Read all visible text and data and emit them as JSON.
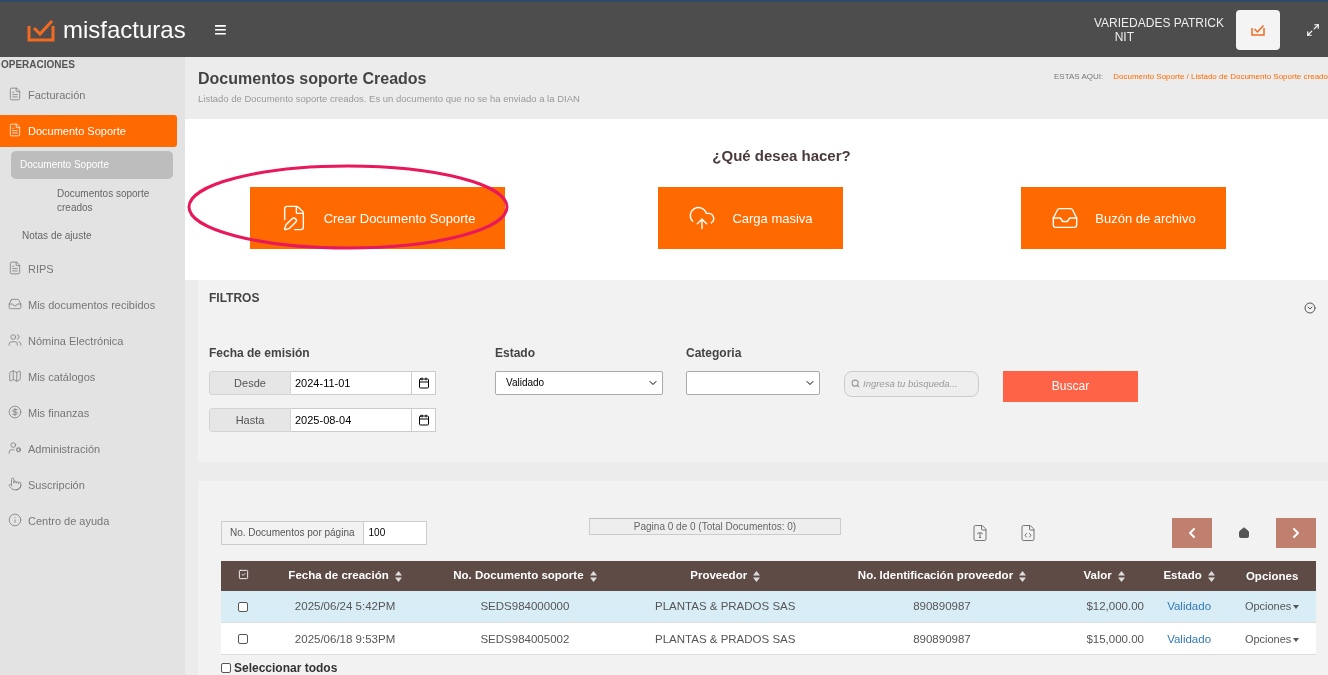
{
  "header": {
    "brand": "misfacturas",
    "menu_glyph": "≡",
    "company": "VARIEDADES PATRICK",
    "nit": "NIT"
  },
  "sidebar": {
    "section": "OPERACIONES",
    "items": [
      {
        "label": "Facturación",
        "kind": "receipt",
        "selected": false
      },
      {
        "label": "Documento Soporte",
        "kind": "receipt",
        "selected": true,
        "children": [
          {
            "label": "Documento Soporte",
            "selected": true,
            "children": [
              {
                "label": "Documentos soporte creados",
                "selected": false
              }
            ]
          },
          {
            "label": "Notas de ajuste",
            "selected": false
          }
        ]
      },
      {
        "label": "RIPS",
        "kind": "receipt",
        "selected": false
      },
      {
        "label": "Mis documentos recibidos",
        "kind": "inbox",
        "selected": false
      },
      {
        "label": "Nómina Electrónica",
        "kind": "users",
        "selected": false
      },
      {
        "label": "Mis catálogos",
        "kind": "map",
        "selected": false
      },
      {
        "label": "Mis finanzas",
        "kind": "dollar",
        "selected": false
      },
      {
        "label": "Administración",
        "kind": "admin",
        "selected": false
      },
      {
        "label": "Suscripción",
        "kind": "hand",
        "selected": false
      },
      {
        "label": "Centro de ayuda",
        "kind": "info",
        "selected": false
      }
    ]
  },
  "page": {
    "title": "Documentos soporte Creados",
    "subtitle": "Listado de Documento soporte creados. Es un documento que no se ha enviado a la DIAN",
    "breadcrumb_label": "ESTAS AQUI:",
    "breadcrumb": "Documento Soporte / Listado de Documento Soporte creado"
  },
  "actions": {
    "question": "¿Qué desea hacer?",
    "buttons": [
      {
        "label": "Crear Documento Soporte",
        "kind": "document",
        "highlighted": true
      },
      {
        "label": "Carga masiva",
        "kind": "upload",
        "highlighted": false
      },
      {
        "label": "Buzón de archivo",
        "kind": "inbox",
        "highlighted": false
      }
    ]
  },
  "filters": {
    "title": "FILTROS",
    "date_label": "Fecha de emisión",
    "from_label": "Desde",
    "from_value": "2024-11-01",
    "to_label": "Hasta",
    "to_value": "2025-08-04",
    "status_label": "Estado",
    "status_value": "Validado",
    "category_label": "Categoria",
    "search_placeholder": "Ingresa tu búsqueda...",
    "search_button": "Buscar"
  },
  "table": {
    "per_page_label": "No. Documentos por página",
    "per_page_value": "100",
    "pagination": "Pagina 0 de 0 (Total Documentos: 0)",
    "columns": [
      "Fecha de creación",
      "No. Documento soporte",
      "Proveedor",
      "No. Identificación proveedor",
      "Valor",
      "Estado",
      "Opciones"
    ],
    "rows": [
      {
        "checked": false,
        "selected": true,
        "cells": [
          "2025/06/24 5:42PM",
          "SEDS984000000",
          "PLANTAS & PRADOS SAS",
          "890890987",
          "$12,000.00"
        ],
        "status": "Validado",
        "options": "Opciones"
      },
      {
        "checked": false,
        "selected": false,
        "cells": [
          "2025/06/18 9:53PM",
          "SEDS984005002",
          "PLANTAS & PRADOS SAS",
          "890890987",
          "$15,000.00"
        ],
        "status": "Validado",
        "options": "Opciones"
      }
    ],
    "select_all": "Seleccionar todos",
    "select_all_checked": false
  }
}
